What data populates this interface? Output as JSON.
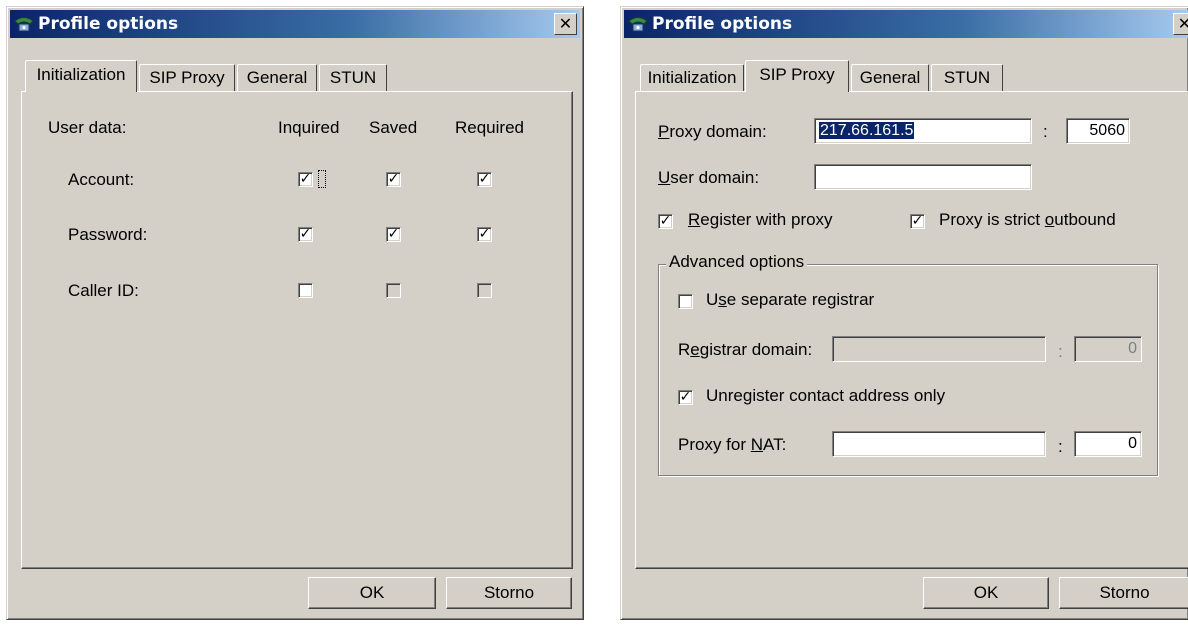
{
  "window_left": {
    "title": "Profile options",
    "tabs": [
      "Initialization",
      "SIP Proxy",
      "General",
      "STUN"
    ],
    "active_tab": "Initialization",
    "user_data_label": "User data:",
    "columns": [
      "Inquired",
      "Saved",
      "Required"
    ],
    "rows": [
      {
        "label": "Account:",
        "inquired": true,
        "saved": true,
        "required": true
      },
      {
        "label": "Password:",
        "inquired": true,
        "saved": true,
        "required": true
      },
      {
        "label": "Caller ID:",
        "inquired": false,
        "saved": false,
        "required": false
      }
    ],
    "ok_label": "OK",
    "cancel_label": "Storno"
  },
  "window_right": {
    "title": "Profile options",
    "tabs": [
      "Initialization",
      "SIP Proxy",
      "General",
      "STUN"
    ],
    "active_tab": "SIP Proxy",
    "proxy_domain_label": "Proxy domain:",
    "proxy_domain_value": "217.66.161.5",
    "colon": ":",
    "proxy_port_value": "5060",
    "user_domain_label": "User domain:",
    "user_domain_value": "",
    "register_with_proxy_label": "Register with proxy",
    "register_with_proxy": true,
    "strict_outbound_label": "Proxy is strict outbound",
    "strict_outbound": true,
    "advanced_legend": "Advanced options",
    "use_separate_registrar_label": "Use separate registrar",
    "use_separate_registrar": false,
    "registrar_domain_label": "Registrar domain:",
    "registrar_domain_value": "",
    "registrar_port_value": "0",
    "unregister_label": "Unregister contact address only",
    "unregister": true,
    "proxy_nat_label": "Proxy for NAT:",
    "proxy_nat_value": "",
    "proxy_nat_port_value": "0",
    "ok_label": "OK",
    "cancel_label": "Storno"
  },
  "icons": {
    "title_icon": "phone-network-icon",
    "close": "close-icon",
    "check": "checkmark-icon"
  }
}
